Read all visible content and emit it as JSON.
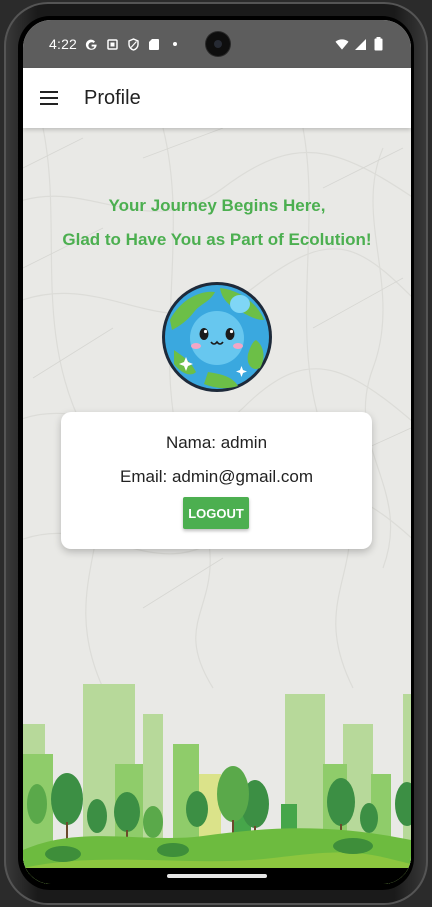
{
  "status_bar": {
    "time": "4:22",
    "left_icons": [
      "google-g-icon",
      "screenshot-icon",
      "shield-icon",
      "sd-card-icon",
      "dot-icon"
    ],
    "right_icons": [
      "wifi-icon",
      "signal-icon",
      "battery-icon"
    ]
  },
  "app_bar": {
    "menu_icon": "hamburger-menu-icon",
    "title": "Profile"
  },
  "welcome": {
    "line1": "Your Journey Begins Here,",
    "line2": "Glad to Have You as Part of Ecolution!",
    "color": "#4caf50"
  },
  "profile_image": "earth-mascot",
  "profile_card": {
    "name_text": "Nama: admin",
    "email_text": "Email: admin@gmail.com",
    "logout_label": "LOGOUT"
  },
  "colors": {
    "accent": "#4caf50",
    "status_bar": "#5d5d5d",
    "background": "#e9e9e6"
  }
}
